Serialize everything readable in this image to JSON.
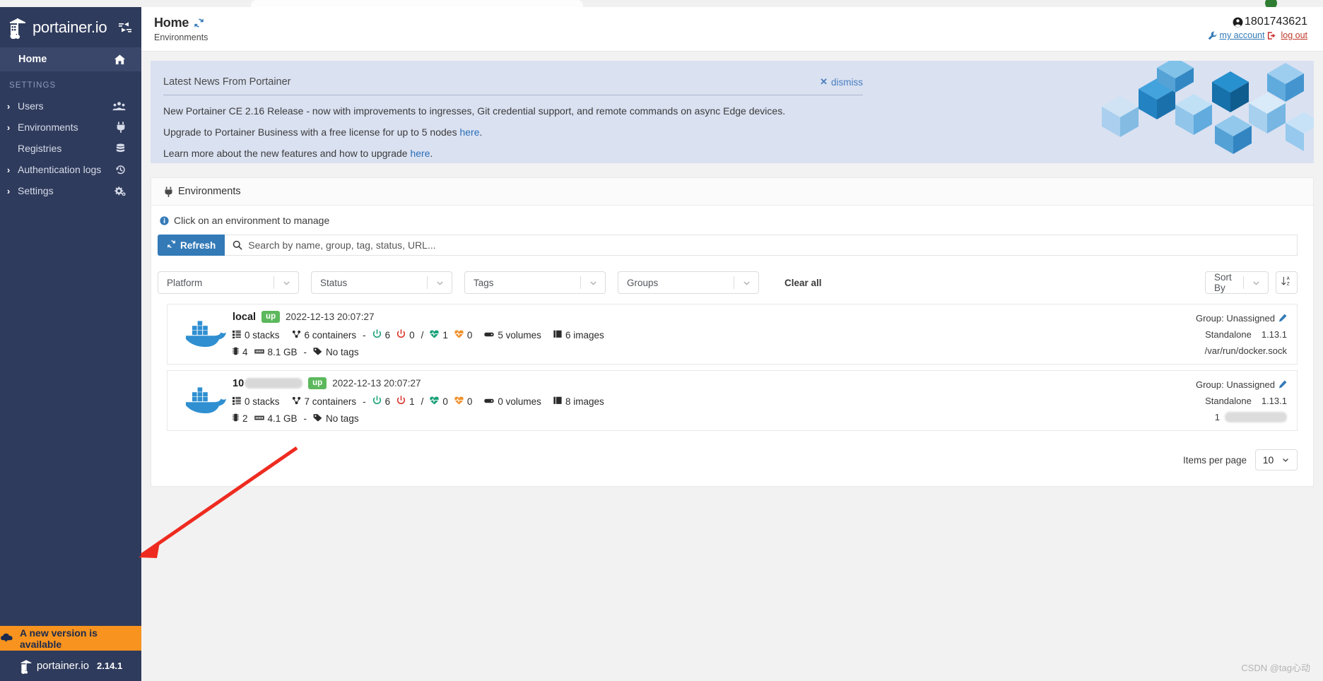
{
  "sidebar": {
    "brand": "portainer.io",
    "brand_icon": "portainer-logo-icon",
    "toggle_icon": "collapse-sidebar-icon",
    "home": {
      "label": "Home",
      "icon": "home-icon"
    },
    "section_label": "SETTINGS",
    "items": [
      {
        "label": "Users",
        "icon": "users-icon",
        "caret": "›"
      },
      {
        "label": "Environments",
        "icon": "plug-icon",
        "caret": "›"
      },
      {
        "label": "Registries",
        "icon": "database-icon",
        "caret": ""
      },
      {
        "label": "Authentication logs",
        "icon": "history-icon",
        "caret": "›"
      },
      {
        "label": "Settings",
        "icon": "cogs-icon",
        "caret": "›"
      }
    ],
    "update_banner": {
      "label": "A new version is available",
      "icon": "cloud-download-icon"
    },
    "version_brand": "portainer.io",
    "version": "2.14.1"
  },
  "header": {
    "title": "Home",
    "refresh_icon": "refresh-icon",
    "subtitle": "Environments",
    "user": "1801743621",
    "user_icon": "user-circle-icon",
    "my_account": "my account",
    "my_account_icon": "wrench-icon",
    "log_out": "log out",
    "log_out_icon": "sign-out-icon"
  },
  "news": {
    "title": "Latest News From Portainer",
    "dismiss": "dismiss",
    "dismiss_icon": "close-icon",
    "line1": "New Portainer CE 2.16 Release - now with improvements to ingresses, Git credential support, and remote commands on async Edge devices.",
    "line2_pre": "Upgrade to Portainer Business with a free license for up to 5 nodes ",
    "line2_link": "here",
    "line2_post": ".",
    "line3_pre": "Learn more about the new features and how to upgrade ",
    "line3_link": "here",
    "line3_post": "."
  },
  "environments_panel": {
    "heading": "Environments",
    "heading_icon": "plug-icon",
    "hint": "Click on an environment to manage",
    "hint_icon": "info-circle-icon",
    "refresh_button": "Refresh",
    "refresh_button_icon": "refresh-icon",
    "search_placeholder": "Search by name, group, tag, status, URL...",
    "search_icon": "search-icon",
    "search_value": "",
    "filters": [
      {
        "name": "platform",
        "label": "Platform"
      },
      {
        "name": "status",
        "label": "Status"
      },
      {
        "name": "tags",
        "label": "Tags"
      },
      {
        "name": "groups",
        "label": "Groups"
      }
    ],
    "clear_all": "Clear all",
    "sort_by": "Sort By",
    "sort_direction_icon": "sort-amount-down-icon",
    "items_per_page_label": "Items per page",
    "items_per_page_value": "10"
  },
  "environments": [
    {
      "icon": "docker-icon",
      "name": "local",
      "name_redacted": false,
      "status": "up",
      "timestamp": "2022-12-13 20:07:27",
      "stacks": "0 stacks",
      "stacks_icon": "stacks-icon",
      "containers": "6 containers",
      "containers_icon": "containers-icon",
      "dash": "-",
      "running": "6",
      "running_icon": "power-running-icon",
      "stopped": "0",
      "stopped_icon": "power-stopped-icon",
      "slash": "/",
      "healthy": "1",
      "healthy_icon": "heartbeat-healthy-icon",
      "unhealthy": "0",
      "unhealthy_icon": "heartbeat-unhealthy-icon",
      "volumes": "5 volumes",
      "volumes_icon": "volumes-icon",
      "images": "6 images",
      "images_icon": "images-icon",
      "cpu": "4",
      "cpu_icon": "cpu-icon",
      "memory": "8.1 GB",
      "memory_icon": "memory-icon",
      "tags_dash": "-",
      "tags": "No tags",
      "tags_icon": "tag-icon",
      "group": "Group: Unassigned",
      "group_edit_icon": "pencil-icon",
      "type": "Standalone",
      "version": "1.13.1",
      "url": "/var/run/docker.sock",
      "url_redacted": false
    },
    {
      "icon": "docker-icon",
      "name": "10",
      "name_redacted": true,
      "status": "up",
      "timestamp": "2022-12-13 20:07:27",
      "stacks": "0 stacks",
      "stacks_icon": "stacks-icon",
      "containers": "7 containers",
      "containers_icon": "containers-icon",
      "dash": "-",
      "running": "6",
      "running_icon": "power-running-icon",
      "stopped": "1",
      "stopped_icon": "power-stopped-icon",
      "slash": "/",
      "healthy": "0",
      "healthy_icon": "heartbeat-healthy-icon",
      "unhealthy": "0",
      "unhealthy_icon": "heartbeat-unhealthy-icon",
      "volumes": "0 volumes",
      "volumes_icon": "volumes-icon",
      "images": "8 images",
      "images_icon": "images-icon",
      "cpu": "2",
      "cpu_icon": "cpu-icon",
      "memory": "4.1 GB",
      "memory_icon": "memory-icon",
      "tags_dash": "-",
      "tags": "No tags",
      "tags_icon": "tag-icon",
      "group": "Group: Unassigned",
      "group_edit_icon": "pencil-icon",
      "type": "Standalone",
      "version": "1.13.1",
      "url": "1",
      "url_redacted": true
    }
  ],
  "watermark": "CSDN @tag心动",
  "colors": {
    "sidebar_bg": "#2f3b5c",
    "accent_blue": "#337ab7",
    "update_orange": "#f7931e",
    "status_up_green": "#5cb85c",
    "news_bg": "#dae1f1",
    "arrow_red": "#ee2b20"
  }
}
